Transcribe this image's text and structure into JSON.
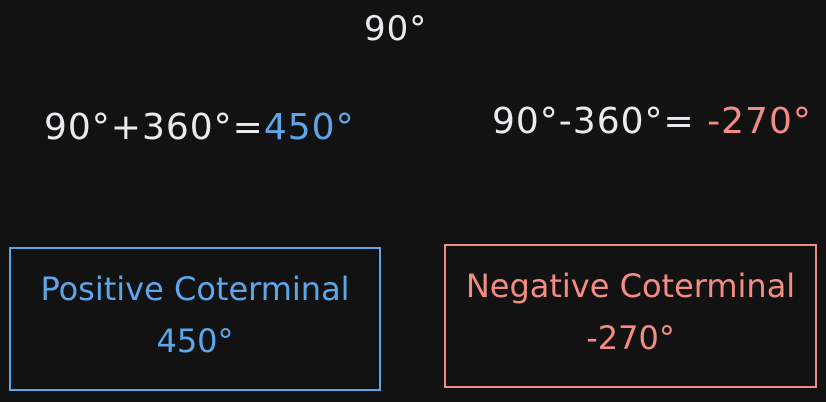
{
  "angle_label": "90°",
  "equations": {
    "positive": {
      "lhs": "90°+360°=",
      "result": "450°"
    },
    "negative": {
      "lhs": "90°-360°=",
      "result": "-270°"
    }
  },
  "boxes": {
    "positive": {
      "title": "Positive Coterminal",
      "value": "450°"
    },
    "negative": {
      "title": "Negative Coterminal",
      "value": "-270°"
    }
  },
  "colors": {
    "background": "#121212",
    "text": "#e9ecef",
    "positive": "#5da6ea",
    "negative": "#f28c84"
  }
}
